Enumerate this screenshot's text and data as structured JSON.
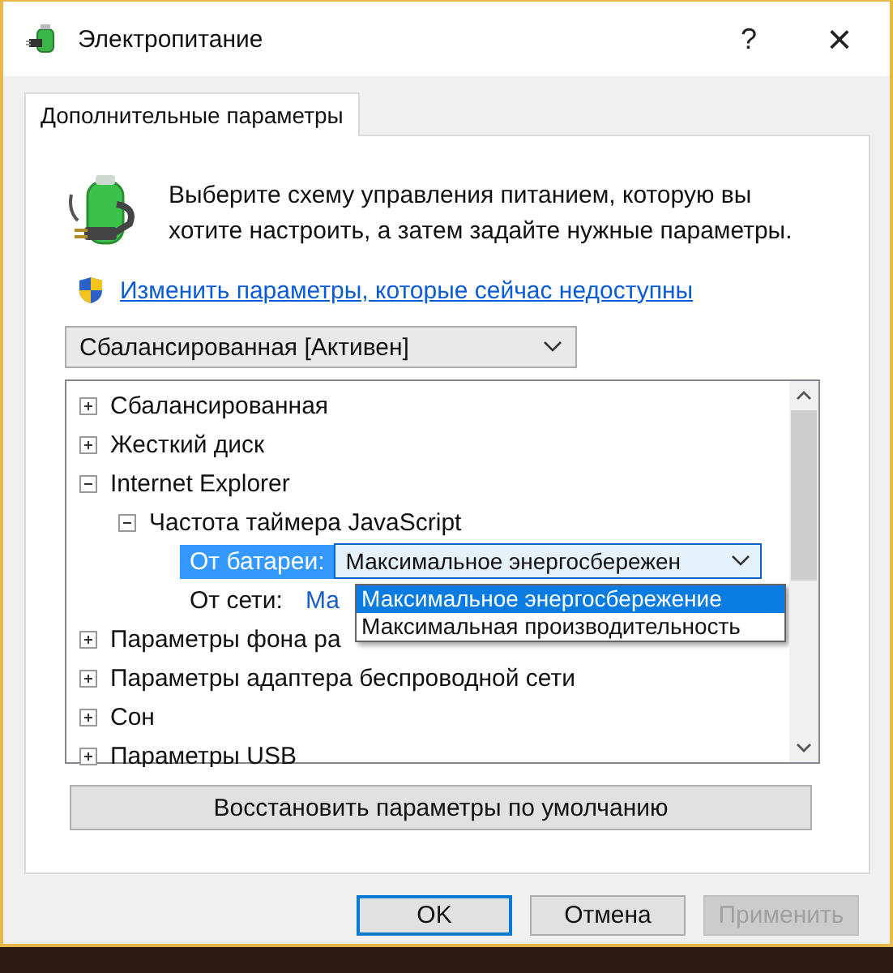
{
  "window": {
    "title": "Электропитание",
    "help": "?",
    "close": "×"
  },
  "tabs": [
    {
      "label": "Дополнительные параметры",
      "selected": true
    }
  ],
  "intro": "Выберите схему управления питанием, которую вы хотите настроить, а затем задайте нужные параметры.",
  "admin_link": "Изменить параметры, которые сейчас недоступны",
  "scheme_select": {
    "value": "Сбалансированная [Активен]"
  },
  "tree": [
    {
      "label": "Сбалансированная",
      "expanded": false
    },
    {
      "label": "Жесткий диск",
      "expanded": false
    },
    {
      "label": "Internet Explorer",
      "expanded": true,
      "children": [
        {
          "label": "Частота таймера JavaScript",
          "expanded": true,
          "children": [
            {
              "kind": "setting",
              "label": "От батареи:",
              "value": "Максимальное энергосбережен",
              "selected": true,
              "open": true,
              "options": [
                {
                  "label": "Максимальное энергосбережение",
                  "selected": true
                },
                {
                  "label": "Максимальная производительность",
                  "selected": false
                }
              ]
            },
            {
              "kind": "setting",
              "label": "От сети:",
              "value": "Ма",
              "selected": false
            }
          ]
        }
      ]
    },
    {
      "label": "Параметры фона ра",
      "expanded": false
    },
    {
      "label": "Параметры адаптера беспроводной сети",
      "expanded": false
    },
    {
      "label": "Сон",
      "expanded": false
    },
    {
      "label": "Параметры USB",
      "expanded": false
    }
  ],
  "restore_button": "Восстановить параметры по умолчанию",
  "buttons": [
    {
      "label": "OK",
      "kind": "default",
      "disabled": false
    },
    {
      "label": "Отмена",
      "kind": "normal",
      "disabled": false
    },
    {
      "label": "Применить",
      "kind": "normal",
      "disabled": true
    }
  ]
}
